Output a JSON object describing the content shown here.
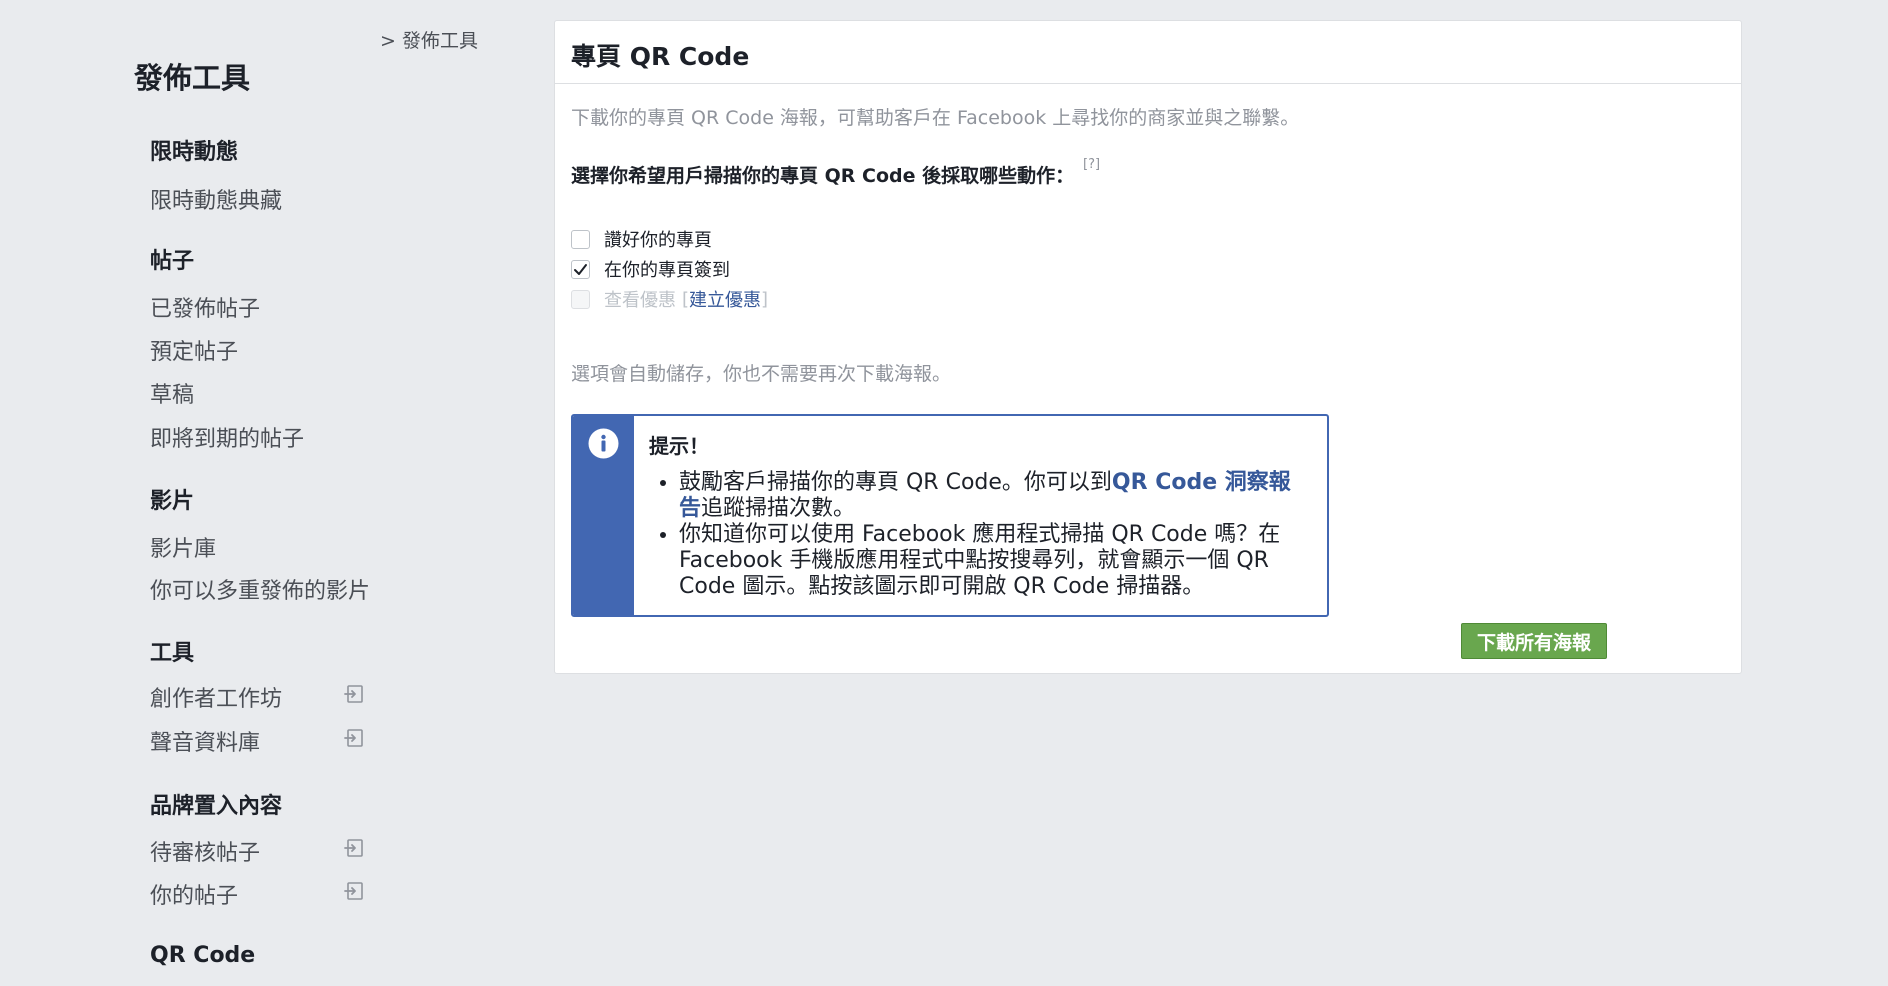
{
  "breadcrumb": "> 發佈工具",
  "sidebar": {
    "title": "發佈工具",
    "sections": {
      "stories": {
        "heading": "限時動態",
        "items": [
          "限時動態典藏"
        ]
      },
      "posts": {
        "heading": "帖子",
        "items": [
          "已發佈帖子",
          "預定帖子",
          "草稿",
          "即將到期的帖子"
        ]
      },
      "videos": {
        "heading": "影片",
        "items": [
          "影片庫",
          "你可以多重發佈的影片"
        ]
      },
      "tools": {
        "heading": "工具",
        "items": [
          "創作者工作坊",
          "聲音資料庫"
        ]
      },
      "branded": {
        "heading": "品牌置入內容",
        "items": [
          "待審核帖子",
          "你的帖子"
        ]
      },
      "qr": {
        "heading": "QR Code"
      }
    },
    "external_icon": "external-link-icon"
  },
  "main": {
    "title": "專頁 QR Code",
    "description": "下載你的專頁 QR Code 海報，可幫助客戶在 Facebook 上尋找你的商家並與之聯繫。",
    "question": "選擇你希望用戶掃描你的專頁 QR Code 後採取哪些動作：",
    "help": "[?]",
    "options": [
      {
        "label": "讚好你的專頁",
        "checked": false,
        "disabled": false
      },
      {
        "label": "在你的專頁簽到",
        "checked": true,
        "disabled": false
      },
      {
        "label": "查看優惠",
        "checked": false,
        "disabled": true,
        "link_open": "[",
        "link": "建立優惠",
        "link_close": "]"
      }
    ],
    "autosave_note": "選項會自動儲存，你也不需要再次下載海報。",
    "tip": {
      "icon": "info-icon",
      "title": "提示！",
      "bullet1_text": "鼓勵客戶掃描你的專頁 QR Code。你可以到",
      "bullet1_link": "QR Code 洞察報告",
      "bullet1_suffix": "追蹤掃描次數。",
      "bullet2": "你知道你可以使用 Facebook 應用程式掃描 QR Code 嗎？在 Facebook 手機版應用程式中點按搜尋列，就會顯示一個 QR Code 圖示。點按該圖示即可開啟 QR Code 掃描器。"
    },
    "download_button": "下載所有海報"
  },
  "colors": {
    "background": "#e9ebee",
    "accent_blue": "#4267b2",
    "link": "#365899",
    "button_green": "#69a74e"
  }
}
